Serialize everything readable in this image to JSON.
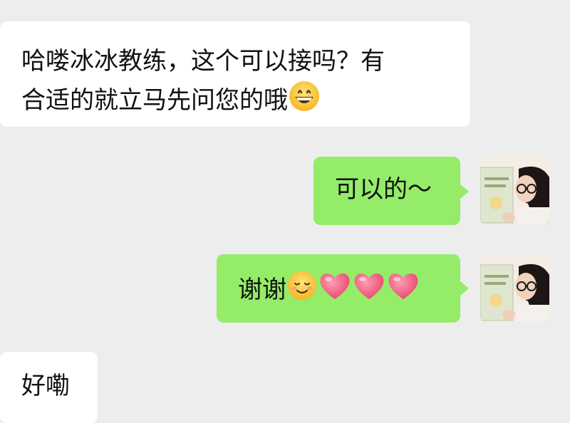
{
  "messages": [
    {
      "side": "left",
      "text_line1": "哈喽冰冰教练，这个可以接吗？有",
      "text_line2": "合适的就立马先问您的哦",
      "emoji": "grinning-face"
    },
    {
      "side": "right",
      "text": "可以的～"
    },
    {
      "side": "right",
      "text": "谢谢",
      "emojis": [
        "smiling-face",
        "heart",
        "heart",
        "heart"
      ]
    },
    {
      "side": "left",
      "text": "好嘞"
    }
  ],
  "colors": {
    "background": "#ededed",
    "received_bubble": "#ffffff",
    "sent_bubble": "#95ec69",
    "text": "#111111"
  }
}
